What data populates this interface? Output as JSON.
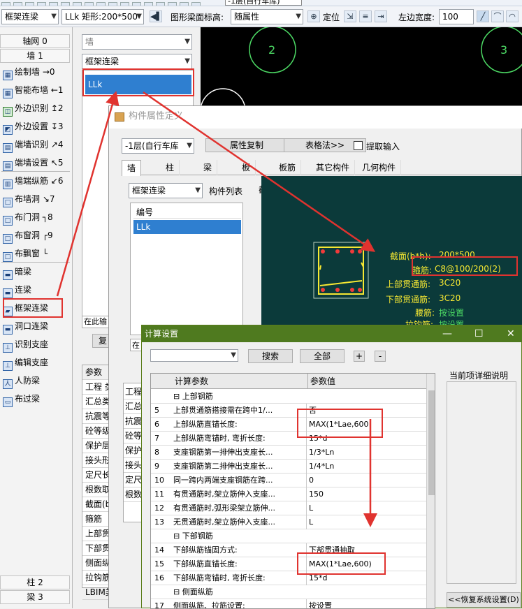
{
  "top_toolbar": {
    "floor_select": "-1层(自行车库)"
  },
  "toolbar2": {
    "type_select": "框架连梁",
    "component_select": "LLk 矩形:200*500",
    "elev_label": "图形梁面标高:",
    "elev_value": "随属性",
    "locate_label": "定位",
    "left_width_label": "左边宽度:",
    "left_width_value": "100"
  },
  "sidebar": {
    "header_axis": "轴网 0",
    "header_wall": "墙 1",
    "items": [
      {
        "label": "绘制墙 →0"
      },
      {
        "label": "智能布墙 ←1"
      },
      {
        "label": "外边识别 ↥2"
      },
      {
        "label": "外边设置 ↧3"
      },
      {
        "label": "端墙识别 ↗4"
      },
      {
        "label": "端墙设置 ↖5"
      },
      {
        "label": "墙端纵筋 ↙6"
      },
      {
        "label": "布墙洞 ↘7"
      },
      {
        "label": "布门洞 ┐8"
      },
      {
        "label": "布窗洞 ┌9"
      },
      {
        "label": "布飘窗 └"
      },
      {
        "label": "暗梁"
      },
      {
        "label": "连梁"
      },
      {
        "label": "框架连梁"
      },
      {
        "label": "洞口连梁"
      },
      {
        "label": "识别支座"
      },
      {
        "label": "编辑支座"
      },
      {
        "label": "人防梁"
      },
      {
        "label": "布过梁"
      }
    ],
    "footer_col": "柱 2",
    "footer_beam": "梁 3"
  },
  "panel2": {
    "select_top": "墙",
    "select_type": "框架连梁",
    "list_item": "LLk",
    "bottom_text": "在此输",
    "bottom_btn": "复",
    "param_header": "参数",
    "params": [
      "工程 类",
      "汇总类",
      "抗震等",
      "砼等级",
      "保护层",
      "接头形",
      "定尺长",
      "根数取",
      "截面(b",
      "箍筋",
      "上部贯通筋",
      "下部贯通筋",
      "侧面纵筋",
      "拉钩筋",
      "LBIM类型"
    ]
  },
  "prop_dialog": {
    "title": "构件属性定义",
    "floor_select": "-1层(自行车库",
    "btn_copy": "属性复制",
    "btn_table": "表格法>>",
    "chk_extract": "提取输入",
    "tabs": [
      "墙",
      "柱",
      "梁",
      "板",
      "板筋",
      "其它构件",
      "几何构件"
    ],
    "type_select": "框架连梁",
    "list_label": "构件列表",
    "section_label": "截面",
    "list_header": "编号",
    "list_item": "LLk",
    "bottom_text": "在",
    "params": [
      "工程",
      "汇总",
      "抗震",
      "砼等",
      "保护",
      "接头",
      "定尺",
      "根数"
    ],
    "section": {
      "dim_label": "截面(b*h):",
      "dim_value": "200*500",
      "stirrup_label": "箍筋:",
      "stirrup_value": "C8@100/200(2)",
      "top_bar_label": "上部贯通筋:",
      "top_bar_value": "3C20",
      "bot_bar_label": "下部贯通筋:",
      "bot_bar_value": "3C20",
      "waist_label": "腰筋:",
      "waist_value": "按设置",
      "tie_label": "拉钩筋:",
      "tie_value": "按设置"
    }
  },
  "calc_dialog": {
    "title": "计算设置",
    "btn_search": "搜索",
    "btn_all": "全部",
    "btn_plus": "+",
    "btn_minus": "-",
    "col_param": "计算参数",
    "col_value": "参数值",
    "right_title": "当前项详细说明",
    "restore_btn": "<<恢复系统设置(D)",
    "rows": [
      {
        "n": "",
        "p": "⊟  上部钢筋",
        "v": ""
      },
      {
        "n": "5",
        "p": "   上部贯通筋搭接需在跨中1/...",
        "v": "否"
      },
      {
        "n": "6",
        "p": "   上部纵筋直锚长度:",
        "v": "MAX(1*Lae,600"
      },
      {
        "n": "7",
        "p": "   上部纵筋弯锚时, 弯折长度:",
        "v": "15*d"
      },
      {
        "n": "8",
        "p": "   支座钢筋第一排伸出支座长...",
        "v": "1/3*Ln"
      },
      {
        "n": "9",
        "p": "   支座钢筋第二排伸出支座长...",
        "v": "1/4*Ln"
      },
      {
        "n": "10",
        "p": "   同一跨内两端支座钢筋在跨...",
        "v": "0"
      },
      {
        "n": "11",
        "p": "   有贯通筋时,架立筋伸入支座...",
        "v": "150"
      },
      {
        "n": "12",
        "p": "   有贯通筋时,弧形梁架立筋伸...",
        "v": "L"
      },
      {
        "n": "13",
        "p": "   无贯通筋时,架立筋伸入支座...",
        "v": "L"
      },
      {
        "n": "",
        "p": "⊟  下部钢筋",
        "v": ""
      },
      {
        "n": "14",
        "p": "   下部纵筋锚固方式:",
        "v": "下部贯通抽取"
      },
      {
        "n": "15",
        "p": "   下部纵筋直锚长度:",
        "v": "MAX(1*Lae,600)"
      },
      {
        "n": "16",
        "p": "   下部纵筋弯锚时, 弯折长度:",
        "v": "15*d"
      },
      {
        "n": "",
        "p": "⊟  侧面纵筋",
        "v": ""
      },
      {
        "n": "17",
        "p": "   侧面纵筋、拉筋设置:",
        "v": "按设置"
      }
    ]
  },
  "cad": {
    "axis_2": "2",
    "axis_3": "3"
  }
}
